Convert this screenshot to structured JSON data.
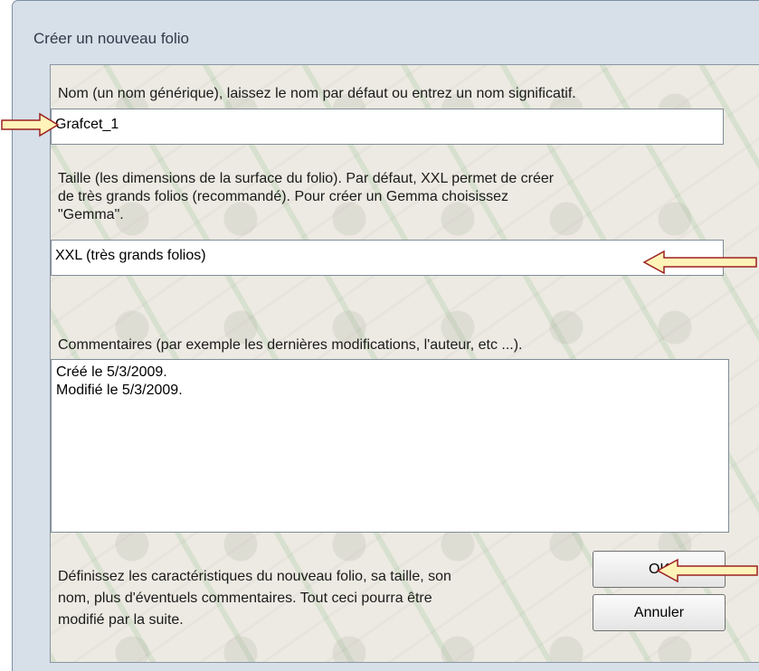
{
  "window": {
    "title": "Créer un nouveau folio"
  },
  "name_section": {
    "label": "Nom (un nom générique), laissez le nom par défaut ou entrez un nom significatif.",
    "value": "Grafcet_1"
  },
  "size_section": {
    "label_lines": [
      "Taille (les dimensions de la surface du folio). Par défaut, XXL permet de créer",
      "de très grands folios (recommandé). Pour créer un Gemma choisissez",
      "\"Gemma\"."
    ],
    "selected_value": "XXL (très grands folios)"
  },
  "comments_section": {
    "label": "Commentaires (par exemple les dernières modifications, l'auteur, etc ...).",
    "lines": [
      "Créé le 5/3/2009.",
      "Modifié le 5/3/2009."
    ]
  },
  "footer": {
    "help_lines": [
      "Définissez les caractéristiques du nouveau folio, sa taille, son",
      "nom, plus d'éventuels commentaires. Tout ceci pourra être",
      "modifié par la suite."
    ],
    "ok_label": "OK",
    "cancel_label": "Annuler"
  },
  "colors": {
    "arrow_fill": "#fff3b8",
    "arrow_stroke": "#9b2020",
    "window_frame": "#d7dfe8"
  }
}
